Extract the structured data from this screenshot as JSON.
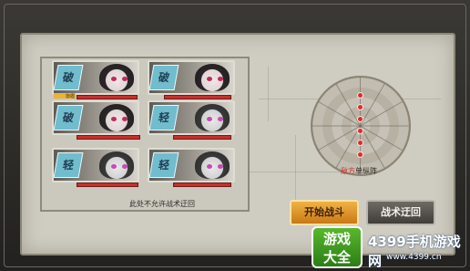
{
  "fleet": {
    "cards": [
      {
        "badge": "破",
        "tone": "color",
        "tag": "旗艦"
      },
      {
        "badge": "破",
        "tone": "color",
        "tag": ""
      },
      {
        "badge": "破",
        "tone": "color",
        "tag": ""
      },
      {
        "badge": "轻",
        "tone": "grey",
        "tag": ""
      },
      {
        "badge": "轻",
        "tone": "grey",
        "tag": ""
      },
      {
        "badge": "轻",
        "tone": "grey",
        "tag": ""
      }
    ],
    "notice": "此处不允许战术迂回"
  },
  "enemy": {
    "label_enemy": "敌方",
    "label_formation": "单纵阵",
    "dots": 6
  },
  "buttons": {
    "start": "开始战斗",
    "retreat": "战术迂回"
  },
  "watermark": {
    "logo_line1": "游戏",
    "logo_line2": "大全",
    "site_name": "4399手机游戏网",
    "site_url": "www.4399.cn"
  },
  "colors": {
    "hp_red": "#c7302c",
    "start_button": "#e39a2e",
    "enemy_text": "#d0302a",
    "badge_blue": "#71bccd"
  }
}
